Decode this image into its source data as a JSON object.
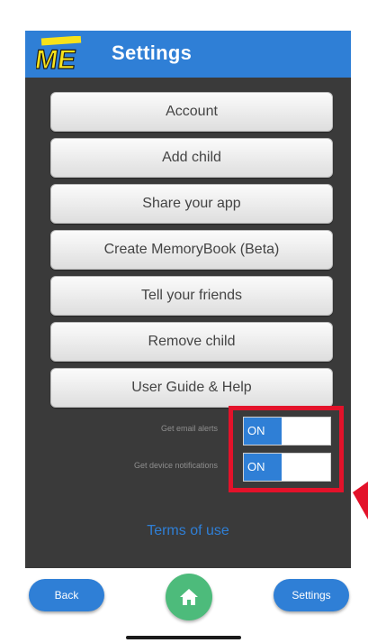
{
  "header": {
    "logo_icon": "me-app-logo-icon",
    "title": "Settings",
    "color": "#2f7fd6"
  },
  "menu": {
    "items": [
      {
        "label": "Account"
      },
      {
        "label": "Add child"
      },
      {
        "label": "Share your app"
      },
      {
        "label": "Create MemoryBook (Beta)"
      },
      {
        "label": "Tell your friends"
      },
      {
        "label": "Remove child"
      },
      {
        "label": "User Guide & Help"
      }
    ]
  },
  "toggles": {
    "email_alerts": {
      "label": "Get email alerts",
      "state": "ON"
    },
    "device_notifications": {
      "label": "Get device notifications",
      "state": "ON"
    }
  },
  "terms": {
    "label": "Terms of use"
  },
  "footer": {
    "back_label": "Back",
    "home_icon": "home-icon",
    "settings_label": "Settings"
  },
  "colors": {
    "accent": "#2f7fd6",
    "panel": "#3a3a3a",
    "home": "#4dbb7b",
    "highlight": "#e3122a"
  }
}
